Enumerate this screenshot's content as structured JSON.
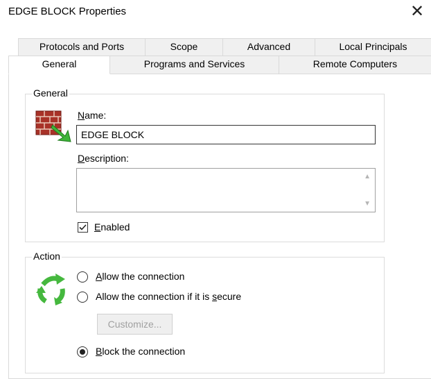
{
  "window": {
    "title": "EDGE BLOCK Properties",
    "close_glyph": "✕"
  },
  "tabs": {
    "row1": [
      "Protocols and Ports",
      "Scope",
      "Advanced",
      "Local Principals"
    ],
    "row2": [
      "General",
      "Programs and Services",
      "Remote Computers"
    ],
    "active": "General"
  },
  "general_group": {
    "label": "General",
    "name_label": {
      "mnemonic": "N",
      "rest": "ame:"
    },
    "name_value": "EDGE BLOCK",
    "description_label": {
      "mnemonic": "D",
      "rest": "escription:"
    },
    "description_value": "",
    "enabled": {
      "checked": true,
      "mnemonic": "E",
      "rest": "nabled"
    }
  },
  "action_group": {
    "label": "Action",
    "options": [
      {
        "pre": "",
        "mnemonic": "A",
        "post": "llow the connection",
        "selected": false
      },
      {
        "pre": "Allow the connection if it is ",
        "mnemonic": "s",
        "post": "ecure",
        "selected": false
      },
      {
        "pre": "",
        "mnemonic": "B",
        "post": "lock the connection",
        "selected": true
      }
    ],
    "customize_button": "Customize..."
  },
  "icons": {
    "firewall": "firewall-brick-icon",
    "action": "green-arrows-icon"
  }
}
